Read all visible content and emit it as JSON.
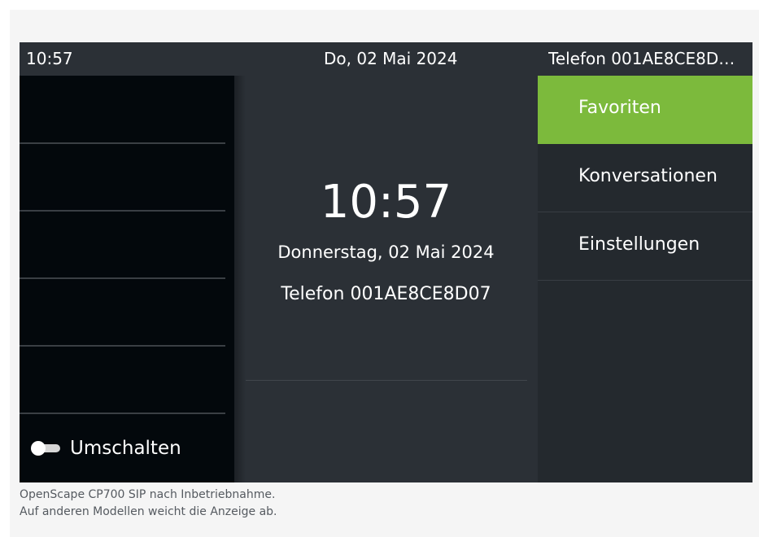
{
  "status_bar": {
    "time": "10:57",
    "date": "Do, 02 Mai 2024",
    "phone": "Telefon 001AE8CE8D…"
  },
  "left_panel": {
    "toggle_label": "Umschalten",
    "toggle_state": "off"
  },
  "center_panel": {
    "clock": "10:57",
    "long_date": "Donnerstag, 02 Mai 2024",
    "phone_name": "Telefon 001AE8CE8D07"
  },
  "menu": {
    "items": [
      {
        "label": "Favoriten",
        "active": true
      },
      {
        "label": "Konversationen",
        "active": false
      },
      {
        "label": "Einstellungen",
        "active": false
      }
    ]
  },
  "caption": {
    "line1": "OpenScape CP700 SIP nach Inbetriebnahme.",
    "line2": "Auf anderen Modellen weicht die Anzeige ab."
  },
  "colors": {
    "accent": "#7cba3c",
    "status_bar": "#2b3036",
    "panel_dark": "#03080c",
    "menu_bg": "#24292e"
  }
}
